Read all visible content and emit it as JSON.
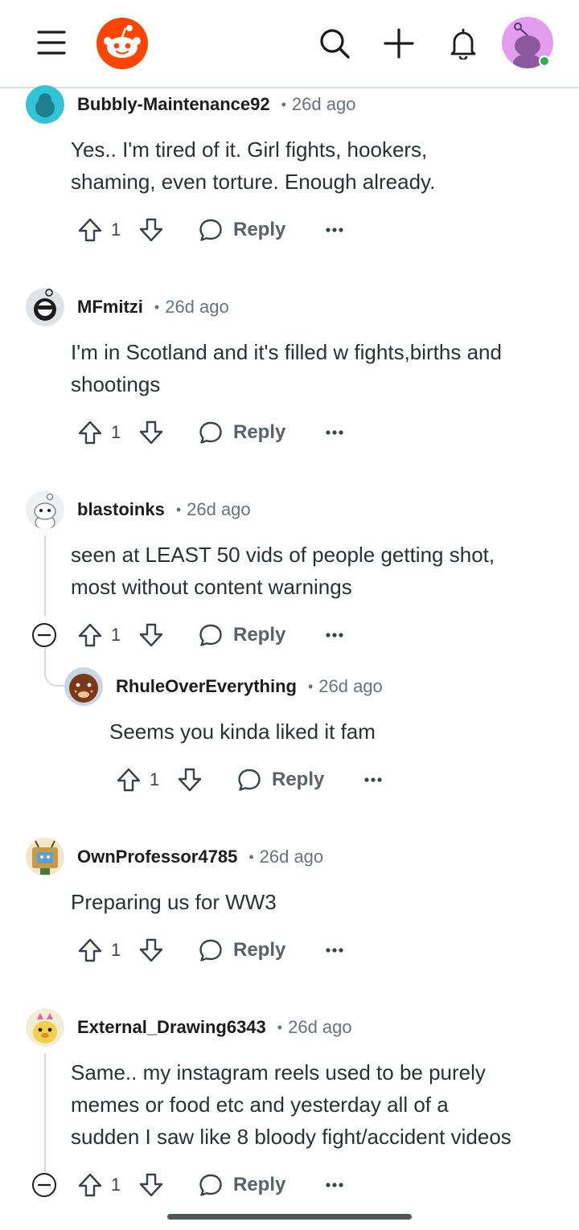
{
  "header": {
    "menu_icon": "hamburger-menu-icon",
    "logo_icon": "reddit-logo-icon",
    "search_icon": "search-icon",
    "create_icon": "plus-icon",
    "notifications_icon": "bell-icon",
    "avatar_icon": "user-avatar-icon",
    "online_color": "#2bb24c"
  },
  "comments": [
    {
      "username": "Bubbly-Maintenance92",
      "time": "26d ago",
      "body": [
        "Yes.. I'm tired of it.  Girl fights,  hookers,",
        "shaming, even torture. Enough already."
      ],
      "votes": "1",
      "reply_label": "Reply"
    },
    {
      "username": "MFmitzi",
      "time": "26d ago",
      "body": [
        "I'm in Scotland and it's filled w fights,births and",
        "shootings"
      ],
      "votes": "1",
      "reply_label": "Reply"
    },
    {
      "username": "blastoinks",
      "time": "26d ago",
      "body": [
        "seen at LEAST 50 vids of people getting shot,",
        "most without content warnings"
      ],
      "votes": "1",
      "reply_label": "Reply"
    },
    {
      "username": "RhuleOverEverything",
      "time": "26d ago",
      "body": [
        "Seems you kinda liked it fam"
      ],
      "votes": "1",
      "reply_label": "Reply"
    },
    {
      "username": "OwnProfessor4785",
      "time": "26d ago",
      "body": [
        "Preparing us for WW3"
      ],
      "votes": "1",
      "reply_label": "Reply"
    },
    {
      "username": "External_Drawing6343",
      "time": "26d ago",
      "body": [
        "Same.. my instagram reels used to be purely",
        "memes or food etc and yesterday all of a",
        "sudden I saw like 8 bloody fight/accident videos"
      ],
      "votes": "1",
      "reply_label": "Reply"
    }
  ],
  "colors": {
    "accent": "#ff4500",
    "meta_text": "#6b7279",
    "body_text": "#2a3034"
  }
}
